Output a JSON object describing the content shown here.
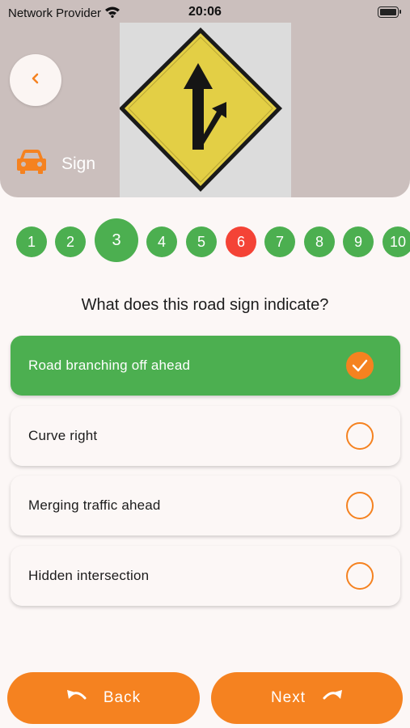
{
  "status_bar": {
    "carrier": "Network Provider",
    "time": "20:06"
  },
  "header": {
    "category": "Sign"
  },
  "question_numbers": [
    {
      "n": "1",
      "state": "correct"
    },
    {
      "n": "2",
      "state": "correct"
    },
    {
      "n": "3",
      "state": "current"
    },
    {
      "n": "4",
      "state": "correct"
    },
    {
      "n": "5",
      "state": "correct"
    },
    {
      "n": "6",
      "state": "wrong"
    },
    {
      "n": "7",
      "state": "correct"
    },
    {
      "n": "8",
      "state": "correct"
    },
    {
      "n": "9",
      "state": "correct"
    },
    {
      "n": "10",
      "state": "correct"
    }
  ],
  "question": "What does this road sign indicate?",
  "options": [
    {
      "label": "Road branching off ahead",
      "selected": true
    },
    {
      "label": "Curve right",
      "selected": false
    },
    {
      "label": "Merging traffic ahead",
      "selected": false
    },
    {
      "label": "Hidden intersection",
      "selected": false
    }
  ],
  "buttons": {
    "back": "Back",
    "next": "Next"
  },
  "colors": {
    "accent": "#f58220",
    "correct": "#4caf50",
    "wrong": "#f44336",
    "header_bg": "#cbbfbd"
  }
}
